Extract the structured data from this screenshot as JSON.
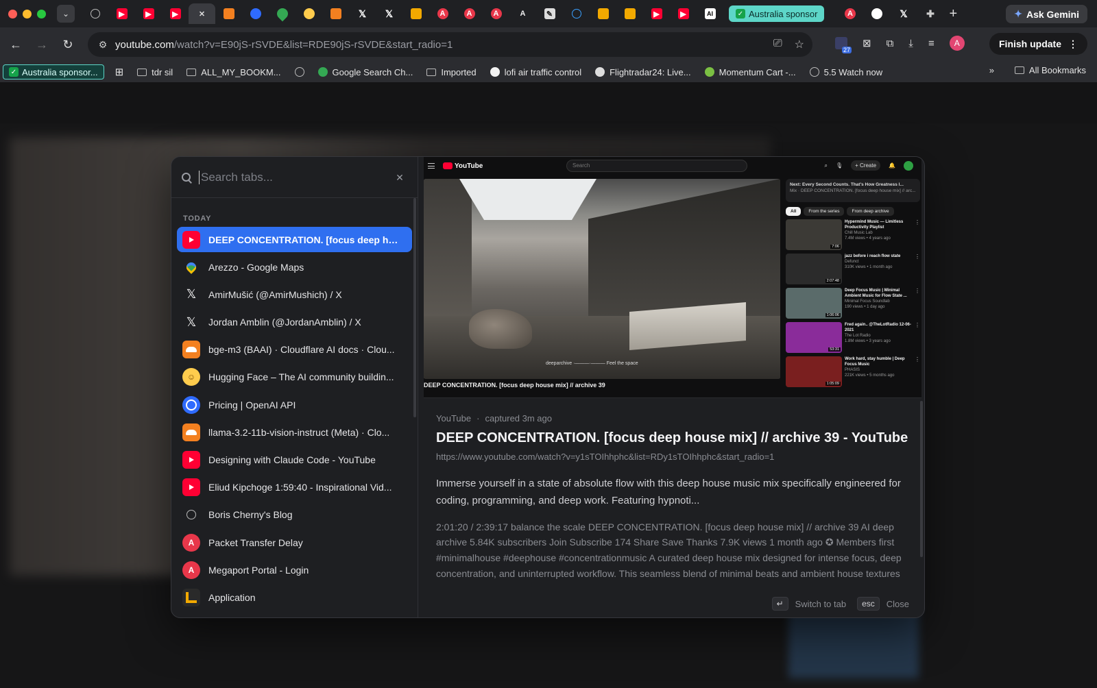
{
  "browser": {
    "active_tab_close": "✕",
    "australia_tab_label": "Australia sponsor",
    "new_tab_symbol": "+",
    "ask_gemini_label": "Ask Gemini",
    "url_domain": "youtube.com",
    "url_rest": "/watch?v=E90jS-rSVDE&list=RDE90jS-rSVDE&start_radio=1",
    "extension_badge_count": "27",
    "profile_initial": "A",
    "finish_update_label": "Finish update"
  },
  "tab_icons": [
    "globe",
    "youtube",
    "youtube",
    "youtube",
    "close",
    "cloudflare",
    "openai",
    "maps",
    "hugging-face",
    "cloudflare",
    "x",
    "x",
    "app",
    "megaport",
    "megaport",
    "megaport",
    "a",
    "pen",
    "c",
    "app",
    "app",
    "youtube",
    "youtube",
    "ai"
  ],
  "tab_icons_after": [
    "megaport",
    "github",
    "x",
    "extensions"
  ],
  "bookmarks": {
    "australia": "Australia sponsor...",
    "items": [
      {
        "label": "tdr sil",
        "icon": "folder"
      },
      {
        "label": "ALL_MY_BOOKM...",
        "icon": "folder"
      },
      {
        "label": "",
        "icon": "globe"
      },
      {
        "label": "Google Search Ch...",
        "icon": "google"
      },
      {
        "label": "Imported",
        "icon": "folder"
      },
      {
        "label": "lofi air traffic control",
        "icon": "lofi"
      },
      {
        "label": "Flightradar24: Live...",
        "icon": "flightradar"
      },
      {
        "label": "Momentum Cart -...",
        "icon": "momentum"
      },
      {
        "label": "5.5 Watch now",
        "icon": "globe"
      }
    ],
    "more": "»",
    "all_bookmarks": "All Bookmarks"
  },
  "switcher": {
    "search_placeholder": "Search tabs...",
    "search_value": "",
    "clear_symbol": "✕",
    "group_label": "TODAY",
    "tabs": [
      {
        "title": "DEEP CONCENTRATION. [focus deep ho...",
        "icon": "yt",
        "selected": true
      },
      {
        "title": "Arezzo - Google Maps",
        "icon": "maps"
      },
      {
        "title": "AmirMušić (@AmirMushich) / X",
        "icon": "x"
      },
      {
        "title": "Jordan Amblin (@JordanAmblin) / X",
        "icon": "x"
      },
      {
        "title": "bge-m3 (BAAI) · Cloudflare AI docs · Clou...",
        "icon": "cf"
      },
      {
        "title": "Hugging Face – The AI community buildin...",
        "icon": "hf"
      },
      {
        "title": "Pricing | OpenAI API",
        "icon": "oai"
      },
      {
        "title": "llama-3.2-11b-vision-instruct (Meta) · Clo...",
        "icon": "cf"
      },
      {
        "title": "Designing with Claude Code - YouTube",
        "icon": "yt"
      },
      {
        "title": "Eliud Kipchoge 1:59:40 - Inspirational Vid...",
        "icon": "yt"
      },
      {
        "title": "Boris Cherny's Blog",
        "icon": "globe"
      },
      {
        "title": "Packet Transfer Delay",
        "icon": "mp"
      },
      {
        "title": "Megaport Portal - Login",
        "icon": "mp"
      },
      {
        "title": "Application",
        "icon": "app"
      }
    ],
    "preview": {
      "mini_logo": "YouTube",
      "mini_search": "Search",
      "mini_create": "+ Create",
      "video_watermark": "deeparchive  ·———·———  Feel the space",
      "video_caption": "DEEP CONCENTRATION. [focus deep house mix] // archive 39",
      "up_next": "Next: Every Second Counts. That's How Greatness I...",
      "up_next_sub": "Mix · DEEP CONCENTRATION. [focus deep house mix] // arc...",
      "chips": [
        "All",
        "From the series",
        "From deep archive"
      ],
      "related": [
        {
          "title": "Hypermind Music — Limitless Productivity Playlist",
          "channel": "Chill Music Lab",
          "meta": "7.4M views • 4 years ago",
          "duration": "7:06",
          "thumb_color": "#3c3a36"
        },
        {
          "title": "jazz before i reach flow state",
          "channel": "Defunct",
          "meta": "310K views • 1 month ago",
          "duration": "2:07:48",
          "thumb_color": "#2b2b2b"
        },
        {
          "title": "Deep Focus Music | Minimal Ambient Music for Flow State ...",
          "channel": "Minimal Focus Soundlab",
          "meta": "190 views • 1 day ago",
          "duration": "1:06:06",
          "thumb_color": "#5a6b6a"
        },
        {
          "title": "Fred again.. @TheLotRadio 12-06-2021",
          "channel": "The Lot Radio",
          "meta": "1.8M views • 3 years ago",
          "duration": "53:31",
          "thumb_color": "#8a2c9a"
        },
        {
          "title": "Work hard, stay humble | Deep Focus Music",
          "channel": "PHASIS",
          "meta": "221K views • 5 months ago",
          "duration": "1:05:09",
          "thumb_color": "#7a1f1f"
        }
      ],
      "source": "YouTube",
      "captured": "captured 3m ago",
      "title": "DEEP CONCENTRATION. [focus deep house mix] // archive 39 - YouTube",
      "url": "https://www.youtube.com/watch?v=y1sTOIhhphc&list=RDy1sTOIhhphc&start_radio=1",
      "description": "Immerse yourself in a state of absolute flow with this deep house music mix specifically engineered for coding, programming, and deep work. Featuring hypnoti...",
      "page_text": "2:01:20 / 2:39:17 balance the scale DEEP CONCENTRATION. [focus deep house mix] // archive 39 AI deep archive 5.84K subscribers Join Subscribe 174 Share Save Thanks 7.9K views 1 month ago ✪ Members first #minimalhouse #deephouse #concentrationmusic A curated deep house mix designed for intense focus, deep concentration, and uninterrupted workflow. This seamless blend of minimal beats and ambient house textures creates the optimal environment for studying, coding, or entering a flow state. The muffled"
    },
    "footer": {
      "enter_key": "↵",
      "switch_label": "Switch to tab",
      "esc_key": "esc",
      "close_label": "Close"
    }
  }
}
